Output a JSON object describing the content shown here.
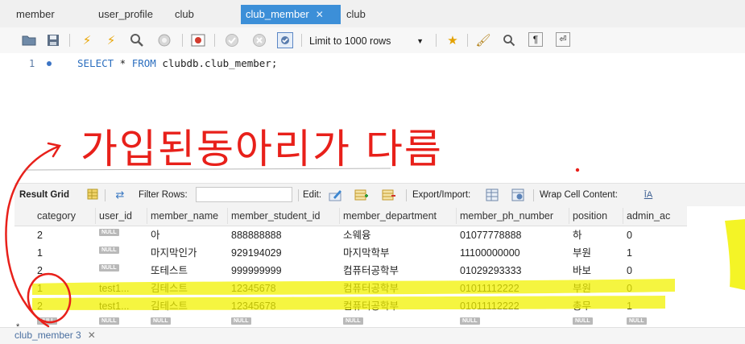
{
  "tabs": [
    {
      "label": "member",
      "active": false
    },
    {
      "label": "user_profile",
      "active": false
    },
    {
      "label": "club",
      "active": false
    },
    {
      "label": "club_member",
      "active": true
    },
    {
      "label": "club",
      "active": false
    }
  ],
  "toolbar": {
    "limit_label": "Limit to 1000 rows",
    "icons": [
      "open-folder-icon",
      "save-icon",
      "execute-icon",
      "execute-current-icon",
      "explain-icon",
      "stop-icon",
      "toggle-output-icon",
      "commit-icon",
      "rollback-icon",
      "autocommit-icon",
      "beautify-icon",
      "find-icon",
      "invisible-chars-icon",
      "wrap-icon"
    ]
  },
  "editor": {
    "line_number": "1",
    "sql_kw1": "SELECT",
    "sql_mid": " * ",
    "sql_kw2": "FROM",
    "sql_rest": " clubdb.club_member;"
  },
  "annotation": {
    "text": "가입된동아리가 다름",
    "color": "#e8201a",
    "highlight_color": "#f2f200"
  },
  "result_toolbar": {
    "result_grid": "Result Grid",
    "filter_rows": "Filter Rows:",
    "edit": "Edit:",
    "export_import": "Export/Import:",
    "wrap_cell": "Wrap Cell Content:"
  },
  "grid": {
    "columns": [
      "category",
      "user_id",
      "member_name",
      "member_student_id",
      "member_department",
      "member_ph_number",
      "position",
      "admin_ac"
    ],
    "rows": [
      [
        "2",
        "NULL",
        "아",
        "888888888",
        "소웨융",
        "01077778888",
        "하",
        "0"
      ],
      [
        "1",
        "NULL",
        "마지막인가",
        "929194029",
        "마지막학부",
        "11100000000",
        "부원",
        "1"
      ],
      [
        "2",
        "NULL",
        "또테스트",
        "999999999",
        "컴퓨터공학부",
        "01029293333",
        "바보",
        "0"
      ],
      [
        "1",
        "test1...",
        "김테스트",
        "12345678",
        "컴퓨터공학부",
        "01011112222",
        "부원",
        "0"
      ],
      [
        "2",
        "test1...",
        "김테스트",
        "12345678",
        "컴퓨터공학부",
        "01011112222",
        "총무",
        "1"
      ],
      [
        "NULL",
        "NULL",
        "NULL",
        "NULL",
        "NULL",
        "NULL",
        "NULL",
        "NULL"
      ]
    ],
    "null_label": "NULL",
    "new_row_marker": "*"
  },
  "bottom_tab": {
    "label": "club_member 3"
  }
}
